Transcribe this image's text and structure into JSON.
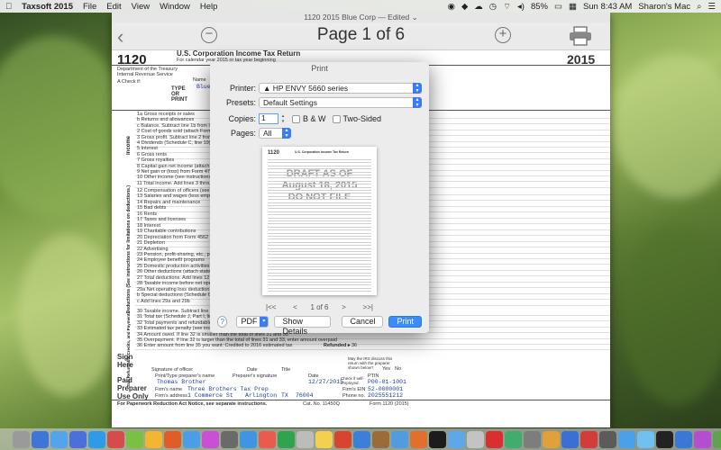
{
  "menubar": {
    "app_name": "Taxsoft 2015",
    "menus": [
      "File",
      "Edit",
      "View",
      "Window",
      "Help"
    ],
    "battery": "85%",
    "clock": "Sun 8:43 AM",
    "user": "Sharon's Mac"
  },
  "window": {
    "title": "1120 2015 Blue Corp — Edited ⌄",
    "page_label": "Page 1 of 6"
  },
  "form": {
    "form_number": "1120",
    "header_title": "U.S. Corporation Income Tax Return",
    "calendar_year": "For calendar year 2015 or tax year beginning",
    "year": "2015",
    "dept": "Department of the Treasury",
    "irs": "Internal Revenue Service",
    "check_if": "A  Check if:",
    "type_or_print": "TYPE OR PRINT",
    "name_short": "Blue",
    "name_field": "Name",
    "income_lines": [
      "1a  Gross receipts or sales",
      "b    Returns and allowances",
      "c    Balance. Subtract line 1b from line 1a",
      "2    Cost of goods sold (attach Form 1125-A)",
      "3    Gross profit. Subtract line 2 from line 1c",
      "4    Dividends (Schedule C, line 19)",
      "5    Interest",
      "6    Gross rents",
      "7    Gross royalties",
      "8    Capital gain net income (attach Schedule D)",
      "9    Net gain or (loss) from Form 4797",
      "10  Other income (see instructions)",
      "11  Total income. Add lines 3 through 10"
    ],
    "deduction_lines": [
      "12  Compensation of officers (see instructions)",
      "13  Salaries and wages (less employment credits)",
      "14  Repairs and maintenance",
      "15  Bad debts",
      "16  Rents",
      "17  Taxes and licenses",
      "18  Interest",
      "19  Charitable contributions",
      "20  Depreciation from Form 4562 not claimed",
      "21  Depletion",
      "22  Advertising",
      "23  Pension, profit-sharing, etc., plans",
      "24  Employee benefit programs",
      "25  Domestic production activities deduction",
      "26  Other deductions (attach statement)",
      "27  Total deductions. Add lines 12 through 26",
      "28  Taxable income before net operating loss",
      "29a Net operating loss deduction (see instructions)",
      "b    Special deductions (Schedule C, line 20)",
      "c    Add lines 29a and 29b"
    ],
    "tax_lines": [
      "30  Taxable income. Subtract line 29c from line 28",
      "31  Total tax (Schedule J, Part I, line 11)",
      "32  Total payments and refundable credits",
      "33  Estimated tax penalty (see instructions)",
      "34  Amount owed. If line 32 is smaller than the total of lines 31 and 33",
      "35  Overpayment. If line 32 is larger than the total of lines 31 and 33, enter amount overpaid",
      "36  Enter amount from line 35 you want: Credited to 2016 estimated tax"
    ],
    "refunded_label": "Refunded ▸",
    "refunded_no": "36",
    "income_side": "Income",
    "deductions_side": "Deductions (See instructions for limitations on deductions.)",
    "tax_side": "Tax, Refundable Credits, and Payments",
    "sign_here": "Sign Here",
    "signature_of_officer": "Signature of officer",
    "date_label": "Date",
    "title_label": "Title",
    "irs_discuss": "May the IRS discuss this return with the preparer shown below?",
    "yes": "Yes",
    "no": "No",
    "paid_preparer": "Paid Preparer Use Only",
    "preparer_name_label": "Print/Type preparer's name",
    "preparer_name": "Thomas Brother",
    "preparer_sig_label": "Preparer's signature",
    "prep_date_label": "Date",
    "prep_date": "12/27/2015",
    "check_self": "Check if self-employed",
    "ptin_label": "PTIN",
    "ptin": "P00-01-1001",
    "firm_name_label": "Firm's name",
    "firm_name": "Three Brothers Tax Prep",
    "firm_ein_label": "Firm's EIN",
    "firm_ein": "52-0000001",
    "firm_addr_label": "Firm's address",
    "firm_addr": "1 Commerce St",
    "firm_city": "Arlington",
    "firm_state": "TX",
    "firm_zip": "76004",
    "phone_label": "Phone no.",
    "phone": "2025551212",
    "footer_left": "For Paperwork Reduction Act Notice, see separate instructions.",
    "cat_no": "Cat. No. 11450Q",
    "footer_right": "Form 1120 (2015)"
  },
  "dialog": {
    "title": "Print",
    "printer_label": "Printer:",
    "printer_value": "HP ENVY 5660 series",
    "presets_label": "Presets:",
    "presets_value": "Default Settings",
    "copies_label": "Copies:",
    "copies_value": "1",
    "bw_label": "B & W",
    "two_sided_label": "Two-Sided",
    "pages_label": "Pages:",
    "pages_value": "All",
    "preview_form": "1120",
    "preview_title": "U.S. Corporation Income Tax Return",
    "watermark_1": "DRAFT AS OF",
    "watermark_2": "August 18, 2015",
    "watermark_3": "DO NOT FILE",
    "page_indicator": "1 of 6",
    "nav_first": "|<<",
    "nav_prev": "<",
    "nav_next": ">",
    "nav_last": ">>|",
    "help": "?",
    "pdf": "PDF",
    "show_details": "Show Details",
    "cancel": "Cancel",
    "print": "Print"
  },
  "colors": {
    "accent": "#3b8cf6",
    "form_value": "#1e3f8f"
  }
}
